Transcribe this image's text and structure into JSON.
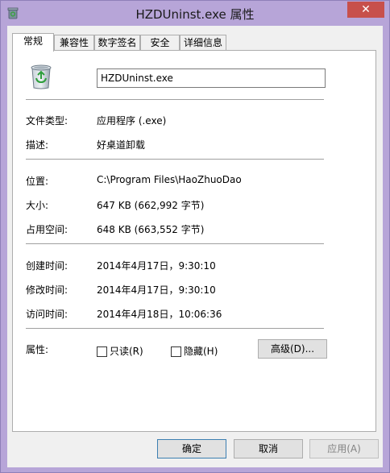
{
  "window": {
    "title": "HZDUninst.exe 属性",
    "close_glyph": "✕"
  },
  "tabs": [
    {
      "label": "常规",
      "active": true
    },
    {
      "label": "兼容性",
      "active": false
    },
    {
      "label": "数字签名",
      "active": false
    },
    {
      "label": "安全",
      "active": false
    },
    {
      "label": "详细信息",
      "active": false
    }
  ],
  "general": {
    "file_name": "HZDUninst.exe",
    "file_type_label": "文件类型:",
    "file_type_value": "应用程序 (.exe)",
    "description_label": "描述:",
    "description_value": "好桌道卸载",
    "location_label": "位置:",
    "location_value": "C:\\Program Files\\HaoZhuoDao",
    "size_label": "大小:",
    "size_value": "647 KB (662,992 字节)",
    "disk_size_label": "占用空间:",
    "disk_size_value": "648 KB (663,552 字节)",
    "created_label": "创建时间:",
    "created_value": "2014年4月17日，9:30:10",
    "modified_label": "修改时间:",
    "modified_value": "2014年4月17日，9:30:10",
    "accessed_label": "访问时间:",
    "accessed_value": "2014年4月18日，10:06:36",
    "attributes_label": "属性:",
    "readonly_label": "只读(R)",
    "hidden_label": "隐藏(H)",
    "advanced_label": "高级(D)..."
  },
  "buttons": {
    "ok": "确定",
    "cancel": "取消",
    "apply": "应用(A)"
  },
  "colors": {
    "title_bar": "#b7a5d8",
    "close_button": "#c7504b",
    "panel_bg": "#ffffff",
    "dialog_bg": "#f0f0f0"
  }
}
